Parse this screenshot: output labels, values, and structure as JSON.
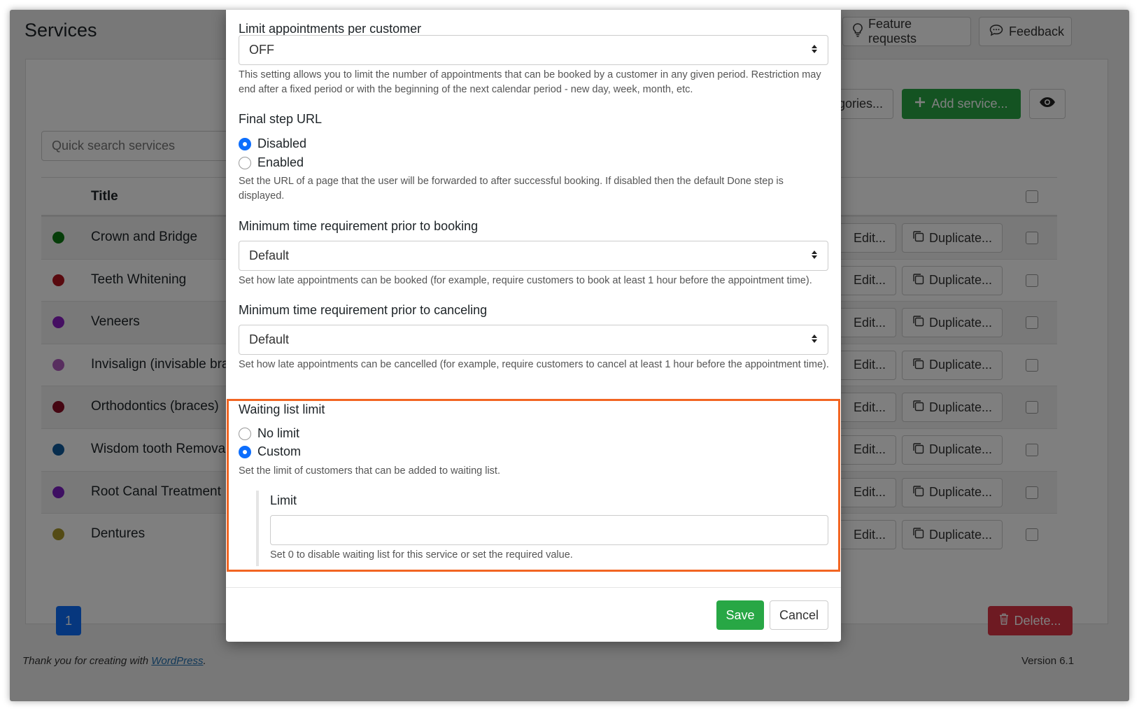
{
  "page": {
    "title": "Services",
    "feature_requests": "Feature requests",
    "feedback": "Feedback",
    "categories_btn": "gories...",
    "add_service": "Add service...",
    "search_placeholder": "Quick search services",
    "table_title_header": "Title",
    "edit_label": "Edit...",
    "duplicate_label": "Duplicate...",
    "pager_current": "1",
    "delete_label": "Delete...",
    "footer_text": "Thank you for creating with",
    "footer_link": "WordPress",
    "footer_period": ".",
    "version": "Version 6.1"
  },
  "services": [
    {
      "title": "Crown and Bridge",
      "color": "#0d7a12"
    },
    {
      "title": "Teeth Whitening",
      "color": "#b3141e"
    },
    {
      "title": "Veneers",
      "color": "#8b1fc4"
    },
    {
      "title": "Invisalign (invisable brac",
      "color": "#b05cbf"
    },
    {
      "title": "Orthodontics (braces)",
      "color": "#8a0d25"
    },
    {
      "title": "Wisdom tooth Removal",
      "color": "#0e5a9c"
    },
    {
      "title": "Root Canal Treatment",
      "color": "#7c1ec4"
    },
    {
      "title": "Dentures",
      "color": "#a8972a"
    }
  ],
  "modal": {
    "limit_appts_label": "Limit appointments per customer",
    "limit_appts_value": "OFF",
    "limit_appts_help": "This setting allows you to limit the number of appointments that can be booked by a customer in any given period. Restriction may end after a fixed period or with the beginning of the next calendar period - new day, week, month, etc.",
    "final_step_label": "Final step URL",
    "final_step_disabled": "Disabled",
    "final_step_enabled": "Enabled",
    "final_step_help": "Set the URL of a page that the user will be forwarded to after successful booking. If disabled then the default Done step is displayed.",
    "min_booking_label": "Minimum time requirement prior to booking",
    "min_booking_value": "Default",
    "min_booking_help": "Set how late appointments can be booked (for example, require customers to book at least 1 hour before the appointment time).",
    "min_cancel_label": "Minimum time requirement prior to canceling",
    "min_cancel_value": "Default",
    "min_cancel_help": "Set how late appointments can be cancelled (for example, require customers to cancel at least 1 hour before the appointment time).",
    "waiting_label": "Waiting list limit",
    "waiting_no_limit": "No limit",
    "waiting_custom": "Custom",
    "waiting_help": "Set the limit of customers that can be added to waiting list.",
    "limit_label": "Limit",
    "limit_value": "",
    "limit_help": "Set 0 to disable waiting list for this service or set the required value.",
    "save": "Save",
    "cancel": "Cancel"
  },
  "colors": {
    "accent_green": "#28a745",
    "primary_blue": "#0d6efd",
    "danger_red": "#dc3545",
    "highlight_orange": "#f26522"
  }
}
